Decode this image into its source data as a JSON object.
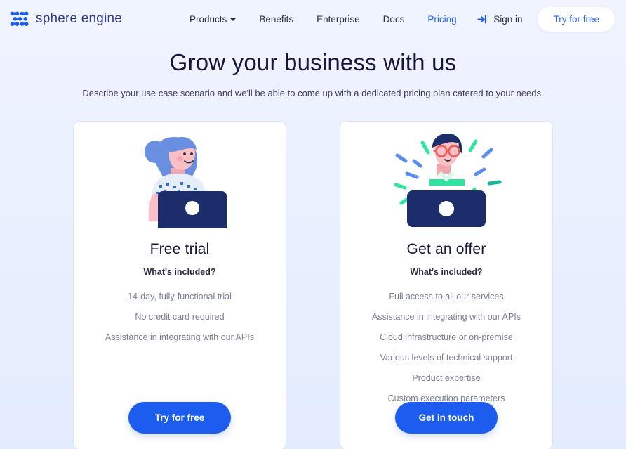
{
  "nav": {
    "brand": "sphere engine",
    "brand_icon": "sphere-engine-logo-icon",
    "links": [
      {
        "label": "Products",
        "active": false,
        "has_caret": true
      },
      {
        "label": "Benefits",
        "active": false,
        "has_caret": false
      },
      {
        "label": "Enterprise",
        "active": false,
        "has_caret": false
      },
      {
        "label": "Docs",
        "active": false,
        "has_caret": false
      },
      {
        "label": "Pricing",
        "active": true,
        "has_caret": false
      }
    ],
    "signin_label": "Sign in",
    "signin_icon": "login-arrow-icon",
    "try_label": "Try for free"
  },
  "hero": {
    "title": "Grow your business with us",
    "subtitle": "Describe your use case scenario and we'll be able to come up with a dedicated pricing plan catered to your needs."
  },
  "cards": [
    {
      "illustration": "woman-at-laptop-illustration",
      "title": "Free trial",
      "subtitle": "What's included?",
      "features": [
        "14-day, fully-functional trial",
        "No credit card required",
        "Assistance in integrating with our APIs"
      ],
      "cta_label": "Try for free"
    },
    {
      "illustration": "man-with-glasses-at-laptop-illustration",
      "title": "Get an offer",
      "subtitle": "What's included?",
      "features": [
        "Full access to all our services",
        "Assistance in integrating with our APIs",
        "Cloud infrastructure or on-premise",
        "Various levels of technical support",
        "Product expertise",
        "Custom execution parameters"
      ],
      "cta_label": "Get in touch"
    }
  ],
  "colors": {
    "brand_blue": "#2563f0",
    "cta_blue": "#1c5df0",
    "page_bg_top": "#f0f4ff",
    "page_bg_bottom": "#e3ecfd",
    "card_bg": "#ffffff",
    "card_border": "#dbe5fa",
    "heading": "#15173a",
    "muted_text": "#7b7f95",
    "logo_navy": "#2e3a8c",
    "illus_navy": "#1b2d6b",
    "illus_green": "#2ee5a0",
    "illus_pink": "#f6b8c6",
    "illus_hair_blue": "#6b8fe0",
    "illus_coral": "#ef5a5a"
  }
}
